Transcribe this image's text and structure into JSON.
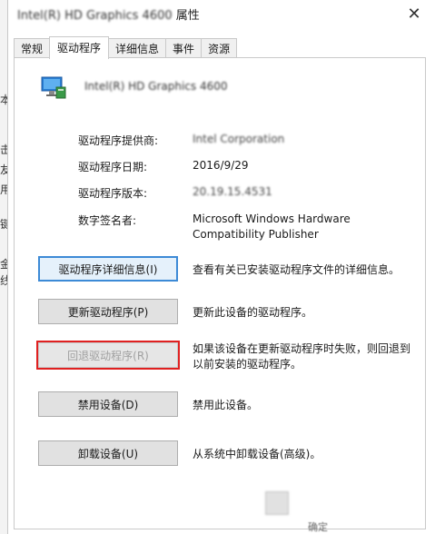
{
  "window": {
    "title_device": "Intel(R) HD Graphics 4600",
    "title_suffix": " 属性",
    "close_glyph": "✕"
  },
  "tabs": [
    {
      "label": "常规"
    },
    {
      "label": "驱动程序"
    },
    {
      "label": "详细信息"
    },
    {
      "label": "事件"
    },
    {
      "label": "资源"
    }
  ],
  "device": {
    "name": "Intel(R) HD Graphics 4600",
    "icon": "display-adapter-icon"
  },
  "properties": [
    {
      "label": "驱动程序提供商:",
      "value": "Intel Corporation"
    },
    {
      "label": "驱动程序日期:",
      "value": "2016/9/29"
    },
    {
      "label": "驱动程序版本:",
      "value": "20.19.15.4531"
    },
    {
      "label": "数字签名者:",
      "value": "Microsoft Windows Hardware Compatibility Publisher"
    }
  ],
  "buttons": [
    {
      "label": "驱动程序详细信息(I)",
      "desc": "查看有关已安装驱动程序文件的详细信息。"
    },
    {
      "label": "更新驱动程序(P)",
      "desc": "更新此设备的驱动程序。"
    },
    {
      "label": "回退驱动程序(R)",
      "desc": "如果该设备在更新驱动程序时失败，则回退到以前安装的驱动程序。"
    },
    {
      "label": "禁用设备(D)",
      "desc": "禁用此设备。"
    },
    {
      "label": "卸载设备(U)",
      "desc": "从系统中卸载设备(高级)。"
    }
  ],
  "background_left": {
    "chars": [
      "本",
      "击",
      "友",
      "用",
      "键",
      "金",
      "线"
    ]
  },
  "footer": {
    "text": "确定"
  },
  "colors": {
    "accent": "#3c8ad6",
    "highlight": "#e02020",
    "button_bg": "#e1e1e1"
  }
}
